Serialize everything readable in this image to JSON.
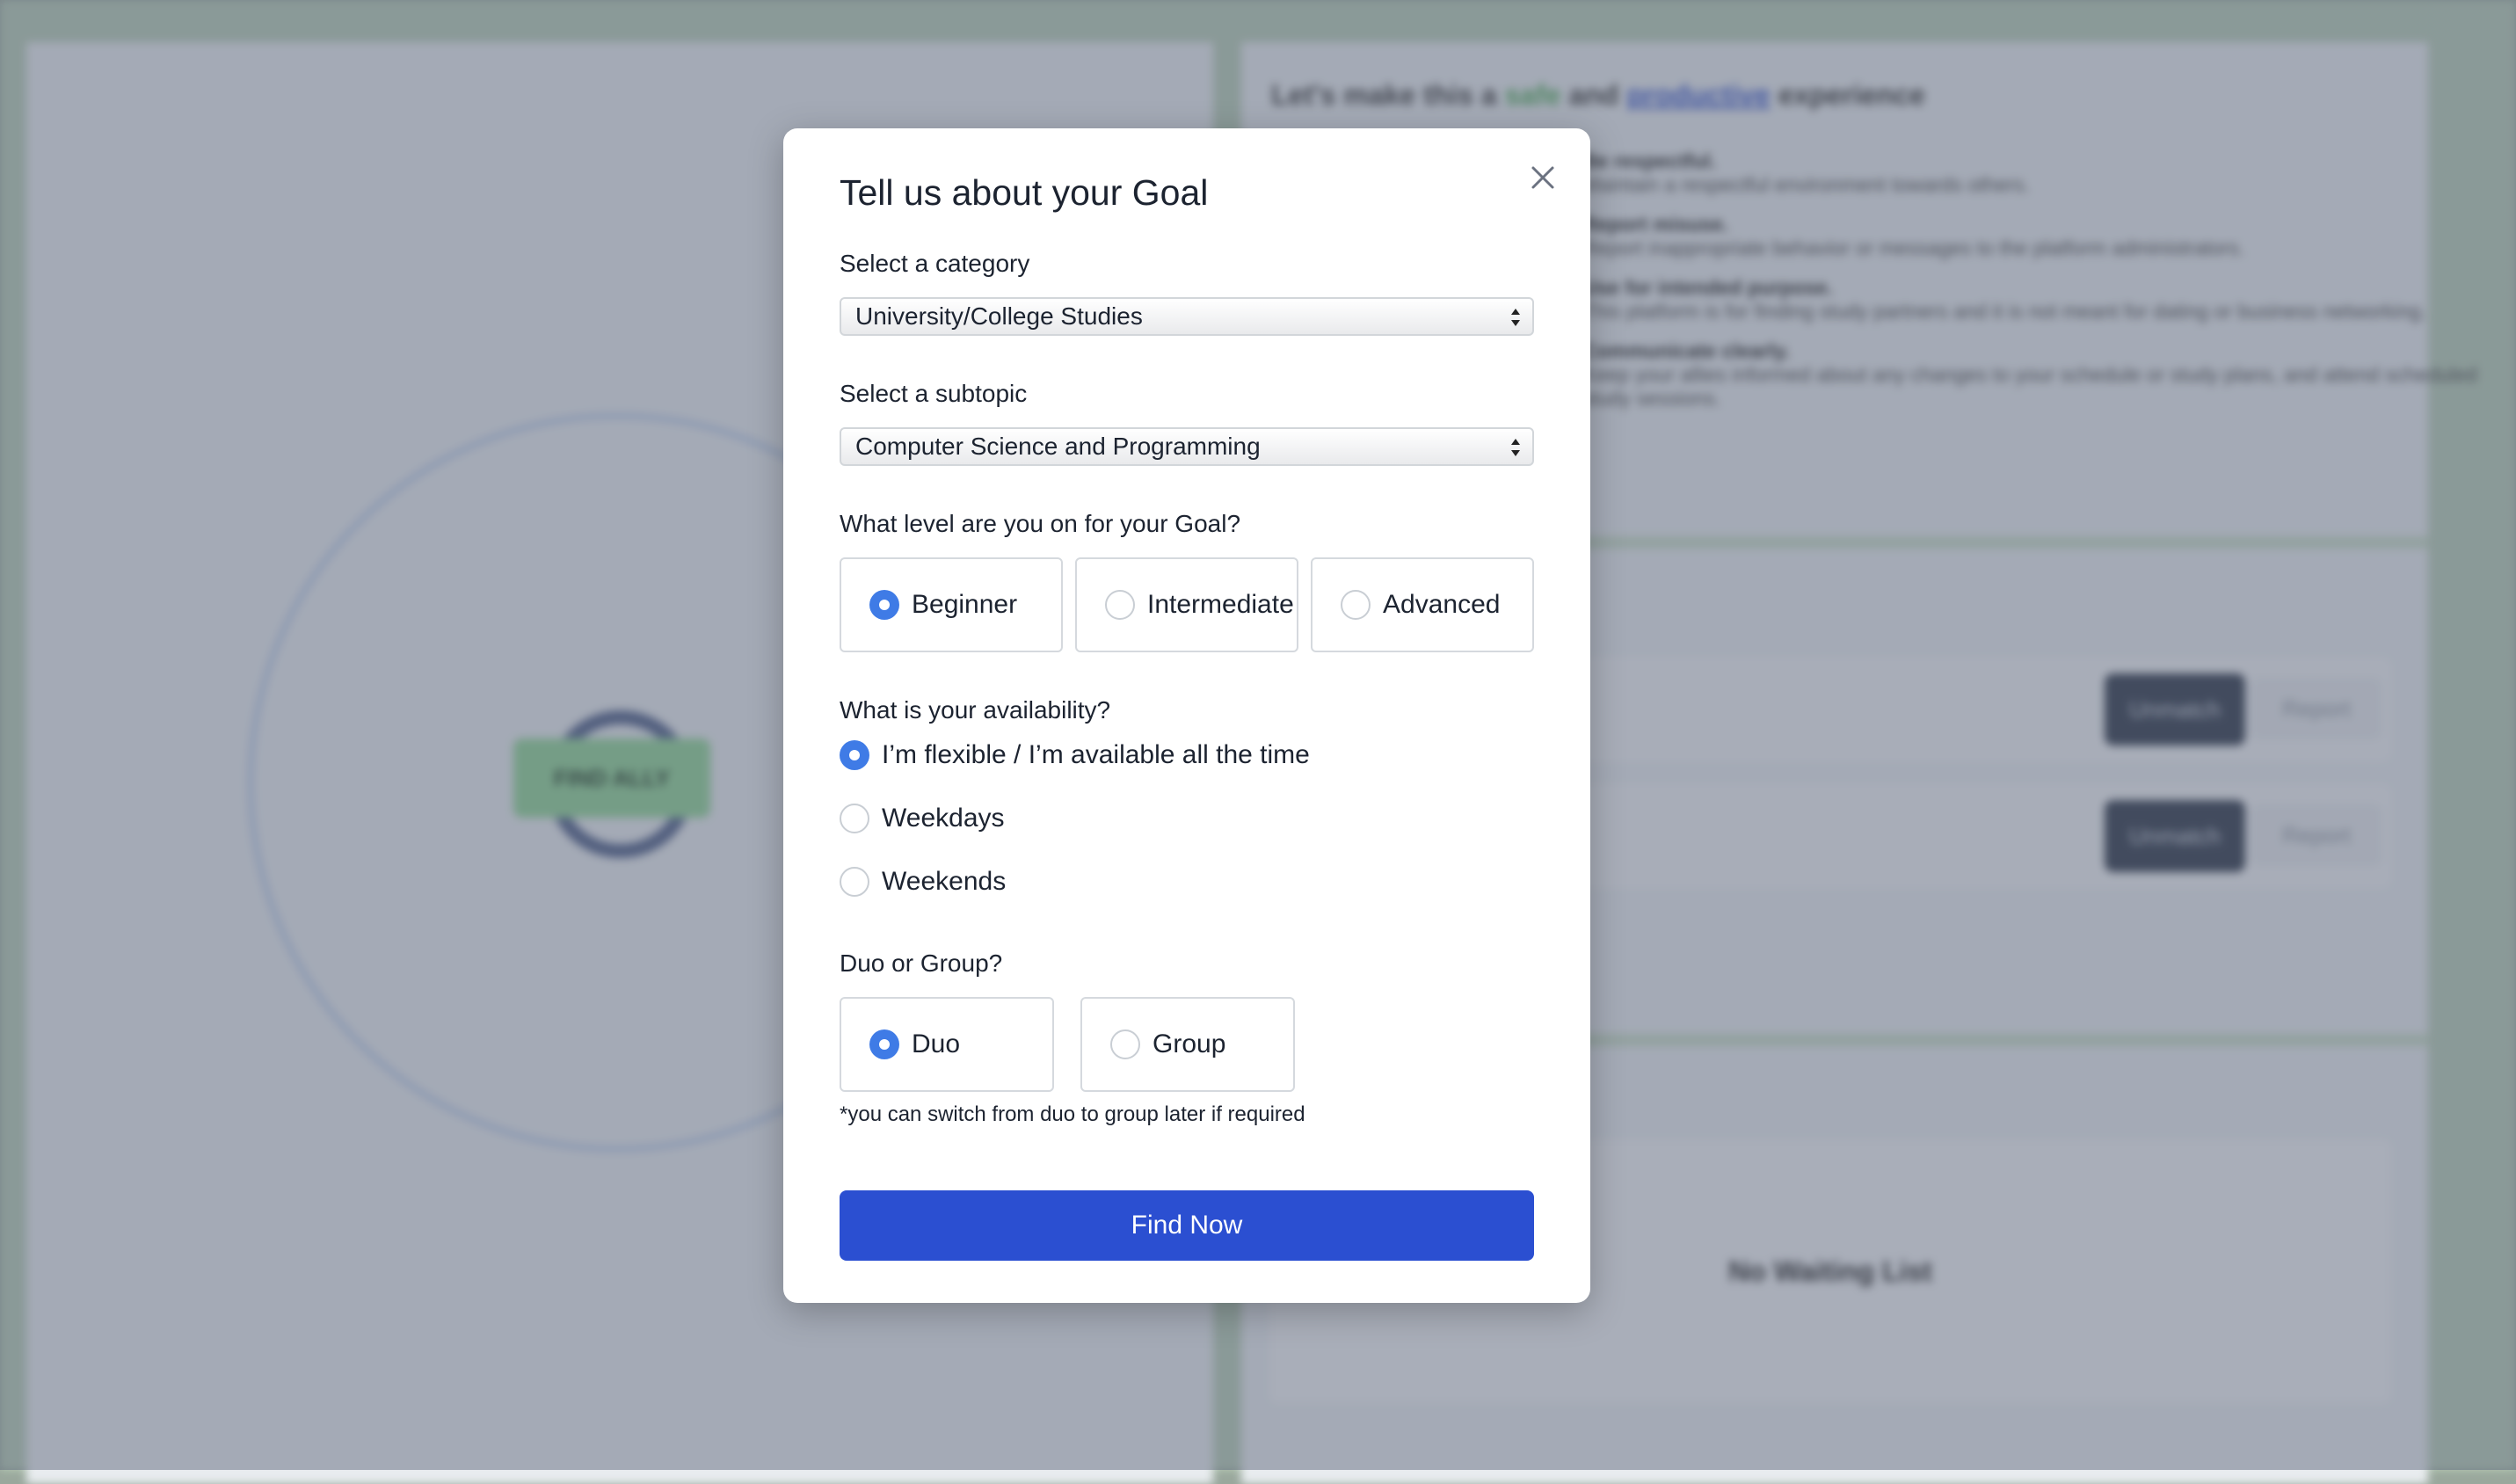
{
  "background": {
    "pill_label": "FIND ALLY",
    "heading_prefix": "Let's make this a",
    "heading_safe": "safe",
    "heading_and": "and",
    "heading_productive": "productive",
    "heading_suffix": "experience",
    "rules": [
      {
        "title": "Be respectful.",
        "text": "Maintain a respectful environment towards others."
      },
      {
        "title": "Report misuse.",
        "text": "Report inappropriate behavior or messages to the platform administrators."
      },
      {
        "title": "Use for intended purpose.",
        "text": "This platform is for finding study partners and it is not meant for dating or business networking."
      },
      {
        "title": "Communicate clearly.",
        "text": "Keep your allies informed about any changes to your schedule or study plans, and attend scheduled study sessions."
      }
    ],
    "card_buttons": {
      "primary": "Unmatch",
      "secondary": "Report"
    },
    "waiting_list_text": "No Waiting List"
  },
  "modal": {
    "title": "Tell us about your Goal",
    "category": {
      "label": "Select a category",
      "value": "University/College Studies"
    },
    "subtopic": {
      "label": "Select a subtopic",
      "value": "Computer Science and Programming"
    },
    "level": {
      "label": "What level are you on for your Goal?",
      "options": [
        "Beginner",
        "Intermediate",
        "Advanced"
      ],
      "selected": "Beginner"
    },
    "availability": {
      "label": "What is your availability?",
      "options": [
        "I’m flexible / I’m available all the time",
        "Weekdays",
        "Weekends"
      ],
      "selected": "I’m flexible / I’m available all the time"
    },
    "group": {
      "label": "Duo or Group?",
      "options": [
        "Duo",
        "Group"
      ],
      "selected": "Duo",
      "note": "*you can switch from duo to group later if required"
    },
    "submit_label": "Find Now",
    "accent_color": "#3f7be6",
    "button_color": "#2b4fd1"
  }
}
